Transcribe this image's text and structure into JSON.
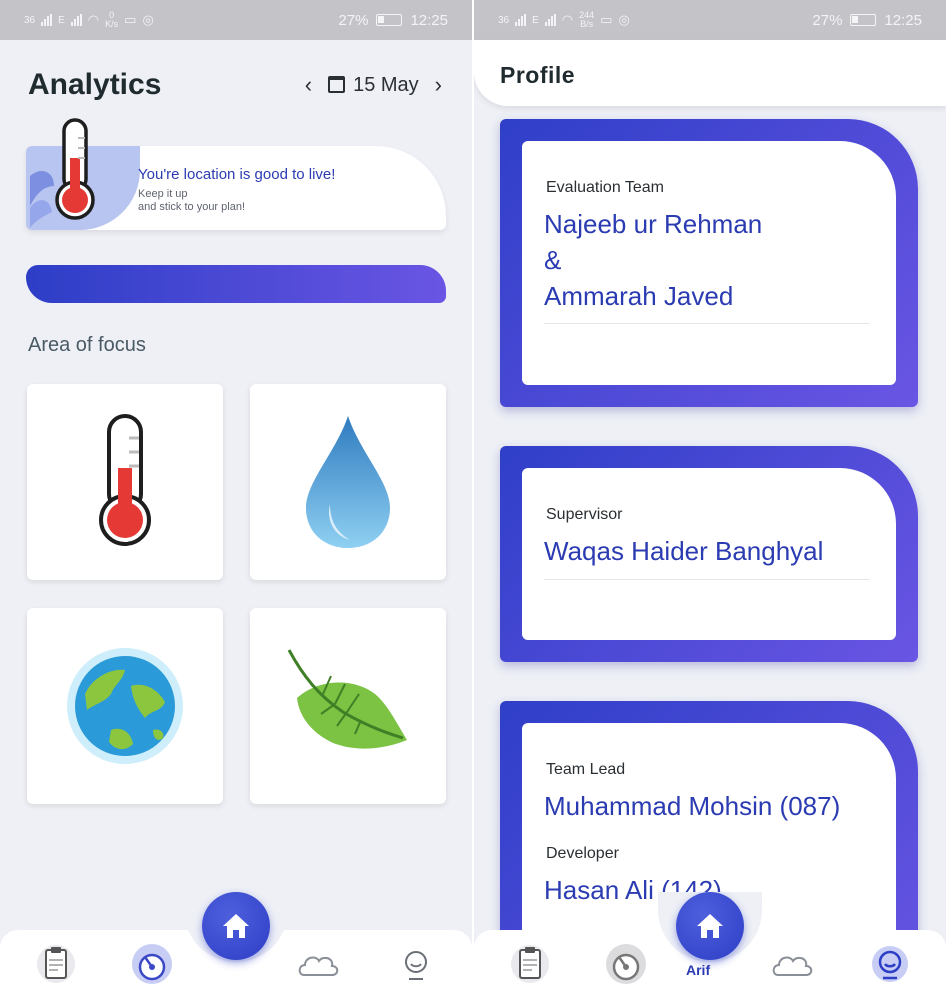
{
  "left": {
    "status": {
      "carrier1": "36",
      "carrier2": "E",
      "speed_value": "0",
      "speed_unit": "K/s",
      "battery": "27%",
      "time": "12:25"
    },
    "header": {
      "title": "Analytics",
      "date": "15 May",
      "prev_icon": "chevron-left-icon",
      "next_icon": "chevron-right-icon",
      "calendar_icon": "calendar-icon"
    },
    "banner": {
      "headline": "You're location is good to live!",
      "line1": "Keep it up",
      "line2": "and stick to your plan!"
    },
    "section_title": "Area of focus",
    "tiles": [
      {
        "icon": "thermometer-icon"
      },
      {
        "icon": "water-drop-icon"
      },
      {
        "icon": "earth-globe-icon"
      },
      {
        "icon": "leaf-icon"
      }
    ]
  },
  "right": {
    "status": {
      "carrier1": "36",
      "carrier2": "E",
      "speed_value": "244",
      "speed_unit": "B/s",
      "battery": "27%",
      "time": "12:25"
    },
    "header": {
      "title": "Profile"
    },
    "cards": [
      {
        "label": "Evaluation Team",
        "name_line1": "Najeeb ur Rehman",
        "name_line2": "&",
        "name_line3": "Ammarah Javed"
      },
      {
        "label": "Supervisor",
        "name": "Waqas Haider Banghyal"
      },
      {
        "label1": "Team Lead",
        "name1": "Muhammad Mohsin (087)",
        "label2": "Developer",
        "name2": "Hasan Ali (142)"
      }
    ],
    "partial_text": "Arif"
  },
  "nav": {
    "items": [
      "clipboard-icon",
      "gauge-icon",
      "home-icon",
      "cloud-icon",
      "user-icon"
    ],
    "accent": "#2d3ec6"
  }
}
